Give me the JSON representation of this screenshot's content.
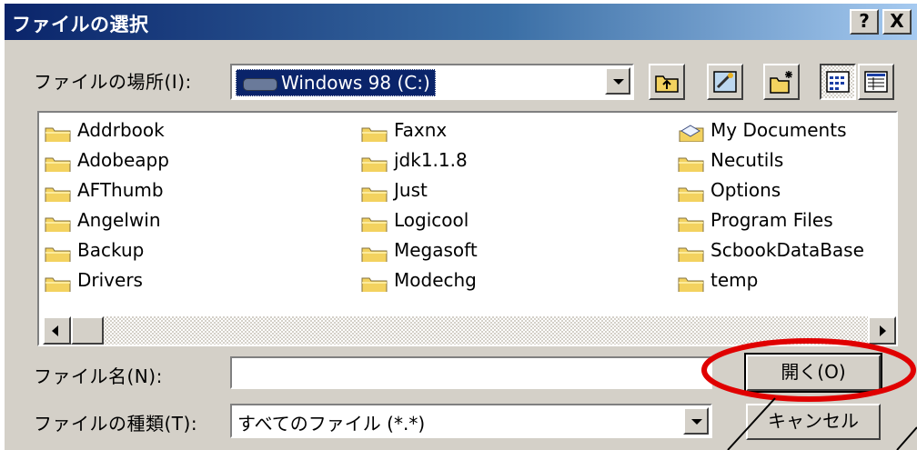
{
  "dialog": {
    "title": "ファイルの選択",
    "help_button": "?",
    "close_button": "X"
  },
  "lookin": {
    "label": "ファイルの場所(I):",
    "value": "Windows 98 (C:)"
  },
  "toolbar": {
    "icons": [
      "up-folder-icon",
      "desktop-icon",
      "new-folder-icon",
      "list-view-icon",
      "details-view-icon"
    ]
  },
  "files": {
    "col1": [
      "Addrbook",
      "Adobeapp",
      "AFThumb",
      "Angelwin",
      "Backup",
      "Drivers"
    ],
    "col2": [
      "Faxnx",
      "jdk1.1.8",
      "Just",
      "Logicool",
      "Megasoft",
      "Modechg"
    ],
    "col3": [
      "My Documents",
      "Necutils",
      "Options",
      "Program Files",
      "ScbookDataBase",
      "temp"
    ]
  },
  "filename": {
    "label": "ファイル名(N):",
    "value": ""
  },
  "filetype": {
    "label": "ファイルの種類(T):",
    "value": "すべてのファイル (*.*)"
  },
  "buttons": {
    "open": "開く(O)",
    "cancel": "キャンセル"
  },
  "colors": {
    "dialog_bg": "#d4d0c8",
    "title_start": "#0a246a",
    "title_end": "#a6caf0",
    "highlight": "#0a246a",
    "annotation": "#e00000",
    "folder": "#f3d25f"
  }
}
